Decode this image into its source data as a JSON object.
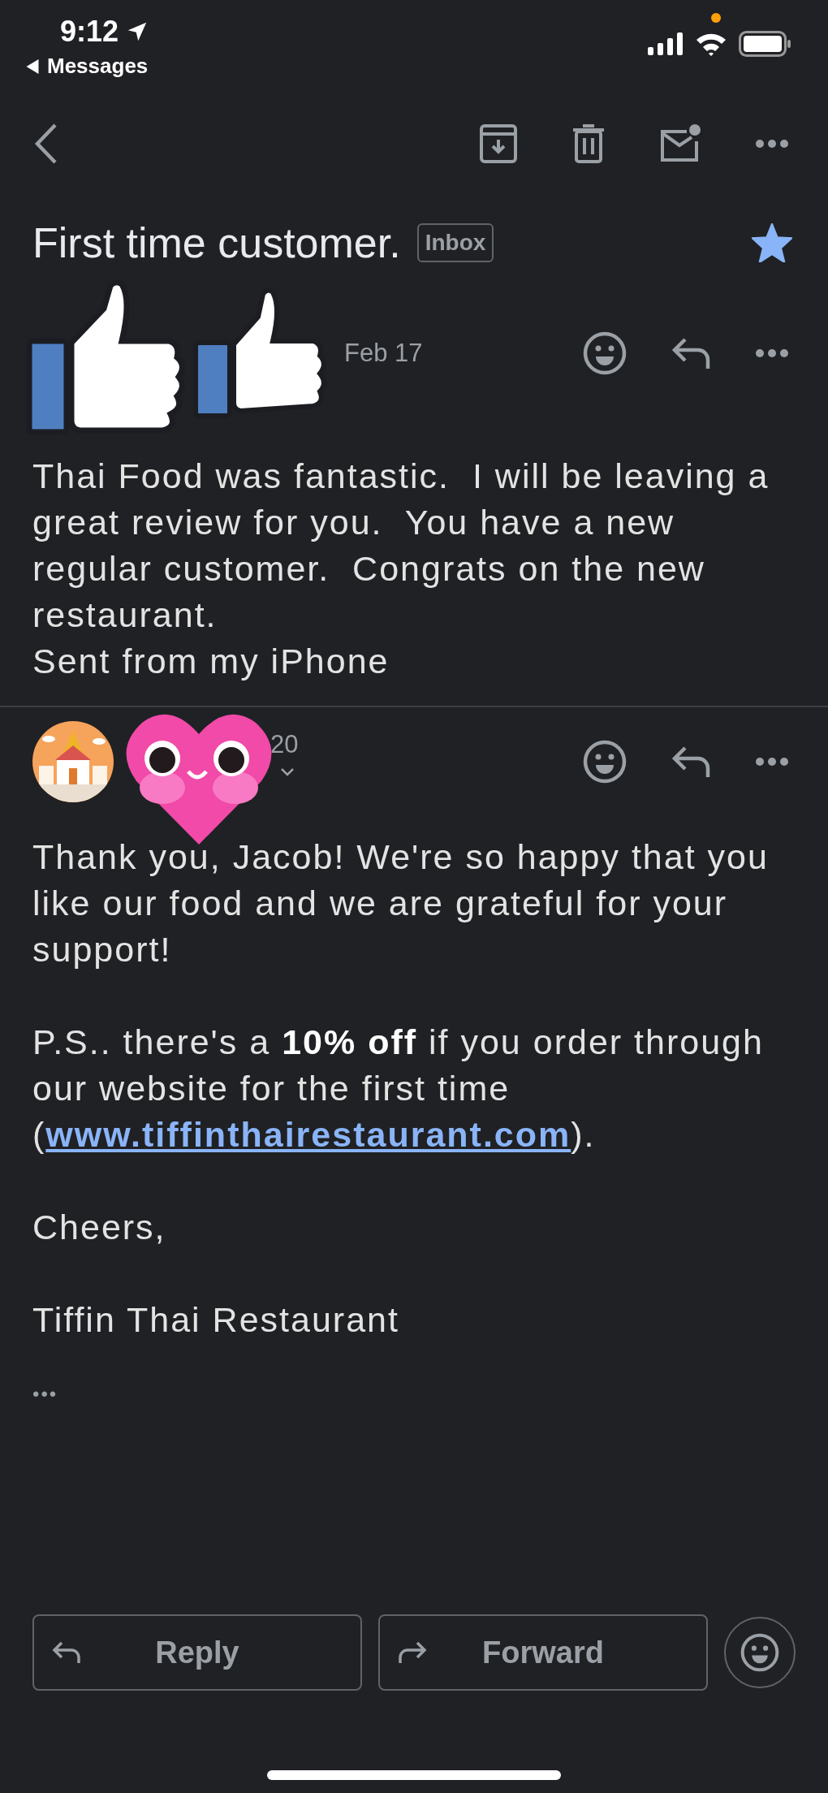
{
  "status_bar": {
    "time": "9:12",
    "back_app": "Messages"
  },
  "thread": {
    "subject": "First time customer.",
    "label": "Inbox",
    "starred": true
  },
  "messages": [
    {
      "date": "Feb 17",
      "has_avatar": false,
      "show_details": false,
      "paragraphs": [
        {
          "text": "Thai Food was fantastic.  I will be leaving a great review for you.  You have a new regular customer.  Congrats on the new restaurant."
        },
        {
          "text": "Sent from my iPhone"
        }
      ]
    },
    {
      "date": "20",
      "has_avatar": true,
      "show_details": true,
      "paragraphs": [
        {
          "text": "Thank you, Jacob! We're so happy that you like our food and we are grateful for your support!"
        },
        {
          "text": "P.S.. there's a **10% off** if you order through our website for the first time (",
          "link": "www.tiffinthairestaurant.com",
          "after": ")."
        },
        {
          "text": "Cheers,"
        },
        {
          "text": "Tiffin Thai Restaurant"
        }
      ],
      "trimmed": "•••"
    }
  ],
  "buttons": [
    {
      "label": "Reply",
      "kind": "reply"
    },
    {
      "label": "Forward",
      "kind": "forward"
    }
  ]
}
